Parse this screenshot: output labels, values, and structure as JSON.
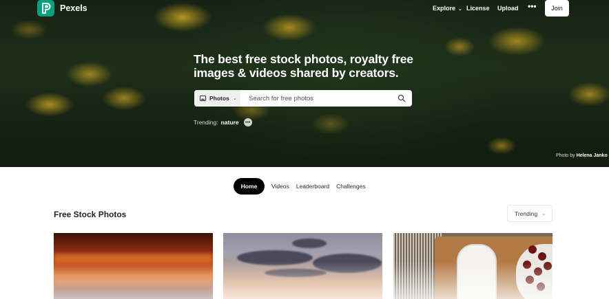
{
  "header": {
    "brand": "Pexels",
    "logo_icon": "pexels-logo-icon",
    "nav": {
      "explore": "Explore",
      "license": "License",
      "upload": "Upload",
      "more": "•••",
      "join": "Join"
    }
  },
  "hero": {
    "title": "The best free stock photos, royalty free images & videos shared by creators.",
    "search": {
      "type_label": "Photos",
      "placeholder": "Search for free photos"
    },
    "trending_label": "Trending:",
    "trending_term": "nature",
    "trending_more": "•••",
    "credit_prefix": "Photo by",
    "credit_author": "Helena Janko"
  },
  "tabs": [
    {
      "label": "Home",
      "active": true
    },
    {
      "label": "Videos"
    },
    {
      "label": "Leaderboard"
    },
    {
      "label": "Challenges"
    }
  ],
  "main": {
    "section_title": "Free Stock Photos",
    "sort_label": "Trending"
  },
  "colors": {
    "brand": "#05a081",
    "active_tab": "#000000"
  }
}
